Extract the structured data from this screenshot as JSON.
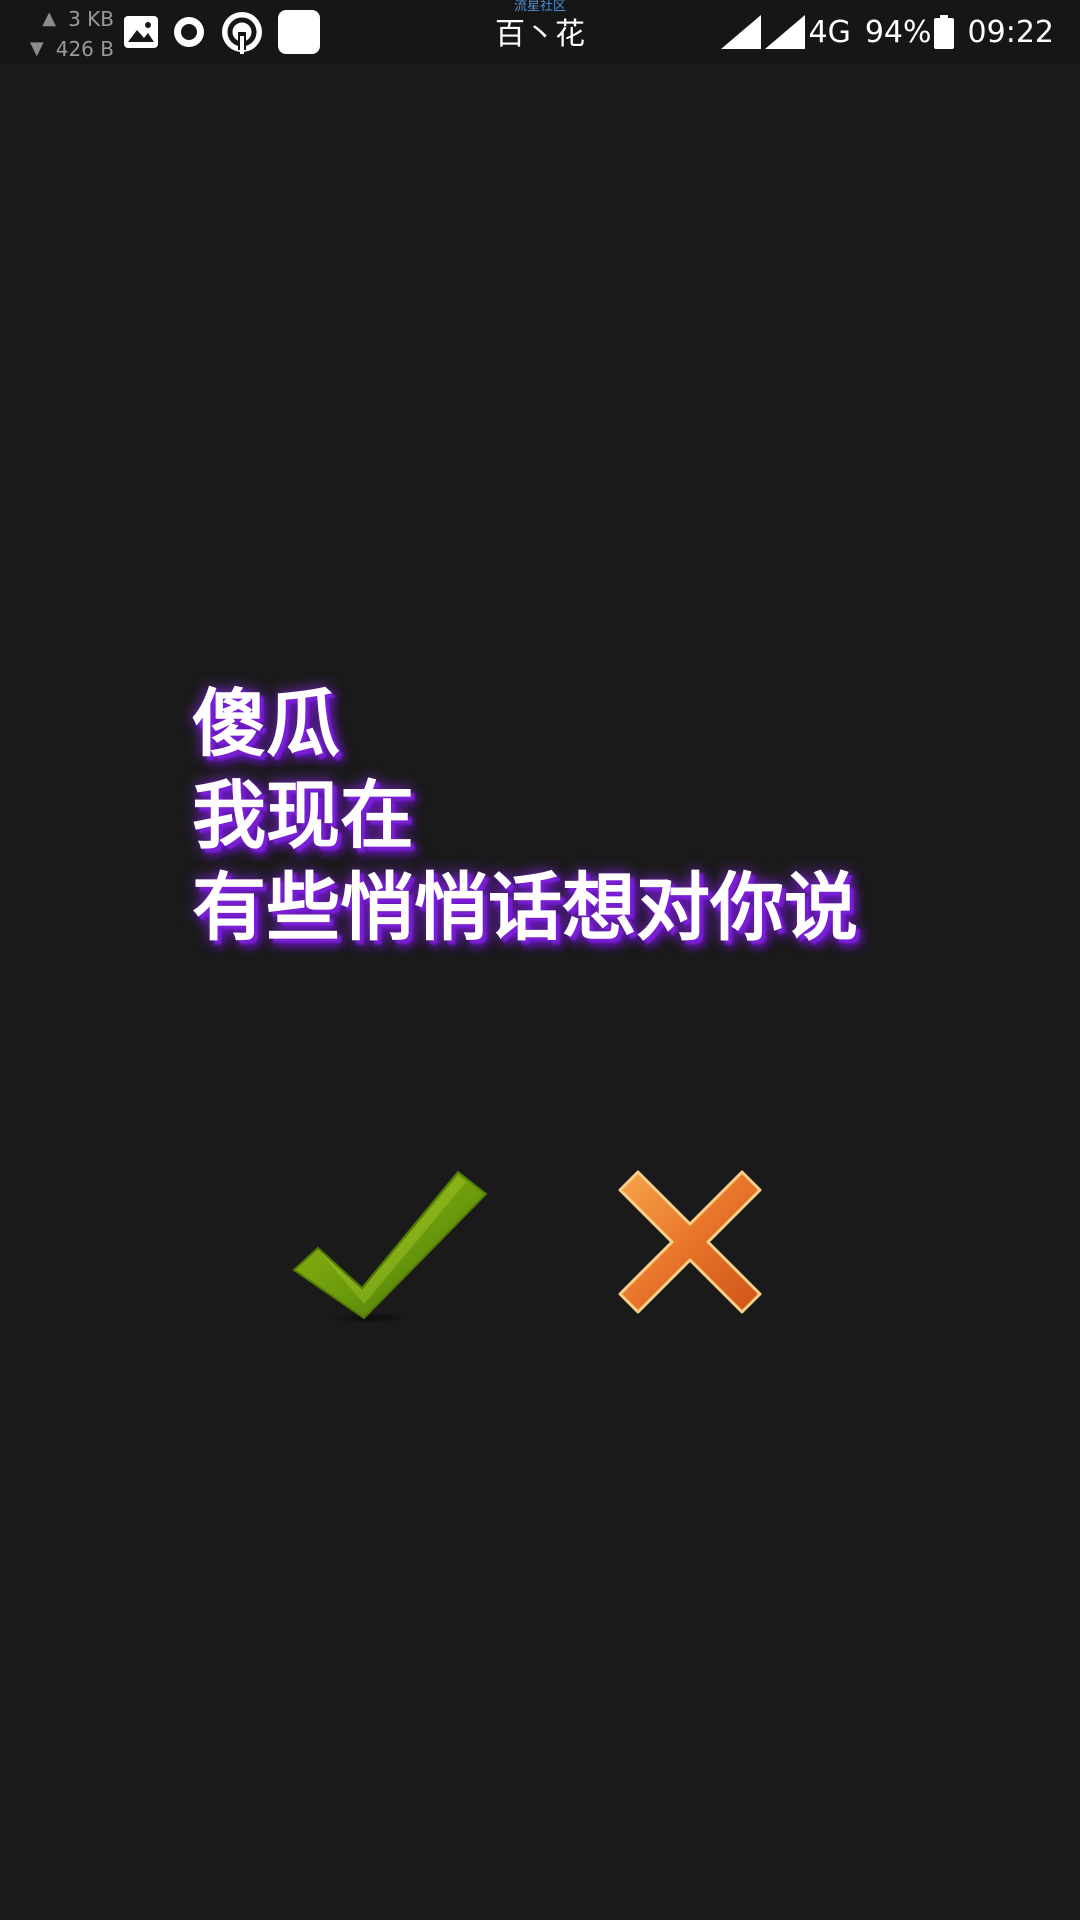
{
  "status_bar": {
    "upload_speed": "3 KB",
    "download_speed": "426 B",
    "carrier_sub": "流星社区",
    "carrier": "百丶花",
    "network_type": "4G",
    "battery_percent": "94%",
    "time": "09:22",
    "notification_icons": [
      "image-icon",
      "circle-app-icon",
      "sync-app-icon",
      "app-icon"
    ],
    "signal_icons": [
      "signal-sim1-icon",
      "signal-sim2-icon"
    ],
    "battery_icon": "battery-icon"
  },
  "message": {
    "lines": [
      "傻瓜",
      "我现在",
      "有些悄悄话想对你说"
    ],
    "text_color": "#ffffff",
    "glow_color": "#7a1fd6"
  },
  "buttons": {
    "accept": {
      "icon": "checkmark-icon",
      "color": "#6b9a0c"
    },
    "reject": {
      "icon": "cross-icon",
      "color": "#e8742a"
    }
  },
  "colors": {
    "background": "#1a1a1a"
  }
}
